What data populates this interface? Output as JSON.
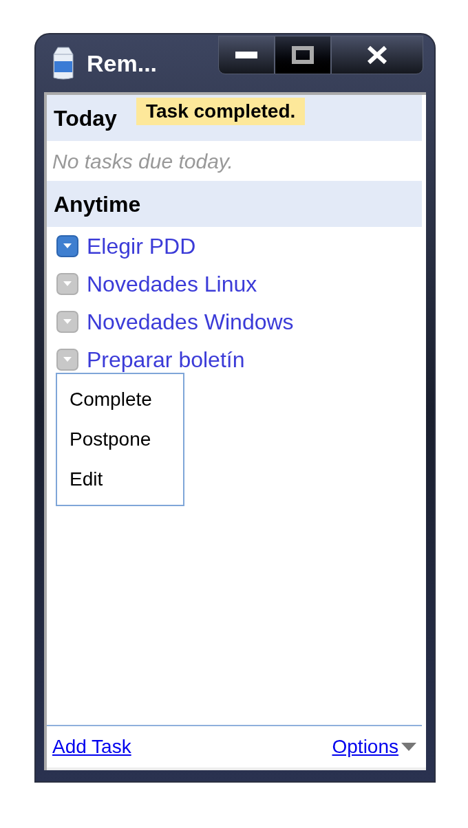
{
  "window": {
    "title": "Rem..."
  },
  "toast": {
    "text": "Task completed."
  },
  "sections": [
    {
      "kind": "header",
      "label": "Today"
    },
    {
      "kind": "empty",
      "label": "No tasks due today."
    },
    {
      "kind": "header",
      "label": "Anytime"
    }
  ],
  "tasks": [
    {
      "label": "Elegir PDD",
      "selected": true
    },
    {
      "label": "Novedades Linux",
      "selected": false
    },
    {
      "label": "Novedades Windows",
      "selected": false
    },
    {
      "label": "Preparar boletín",
      "selected": false
    }
  ],
  "context_menu": {
    "items": [
      "Complete",
      "Postpone",
      "Edit"
    ]
  },
  "footer": {
    "add_task": "Add Task",
    "options": "Options"
  }
}
